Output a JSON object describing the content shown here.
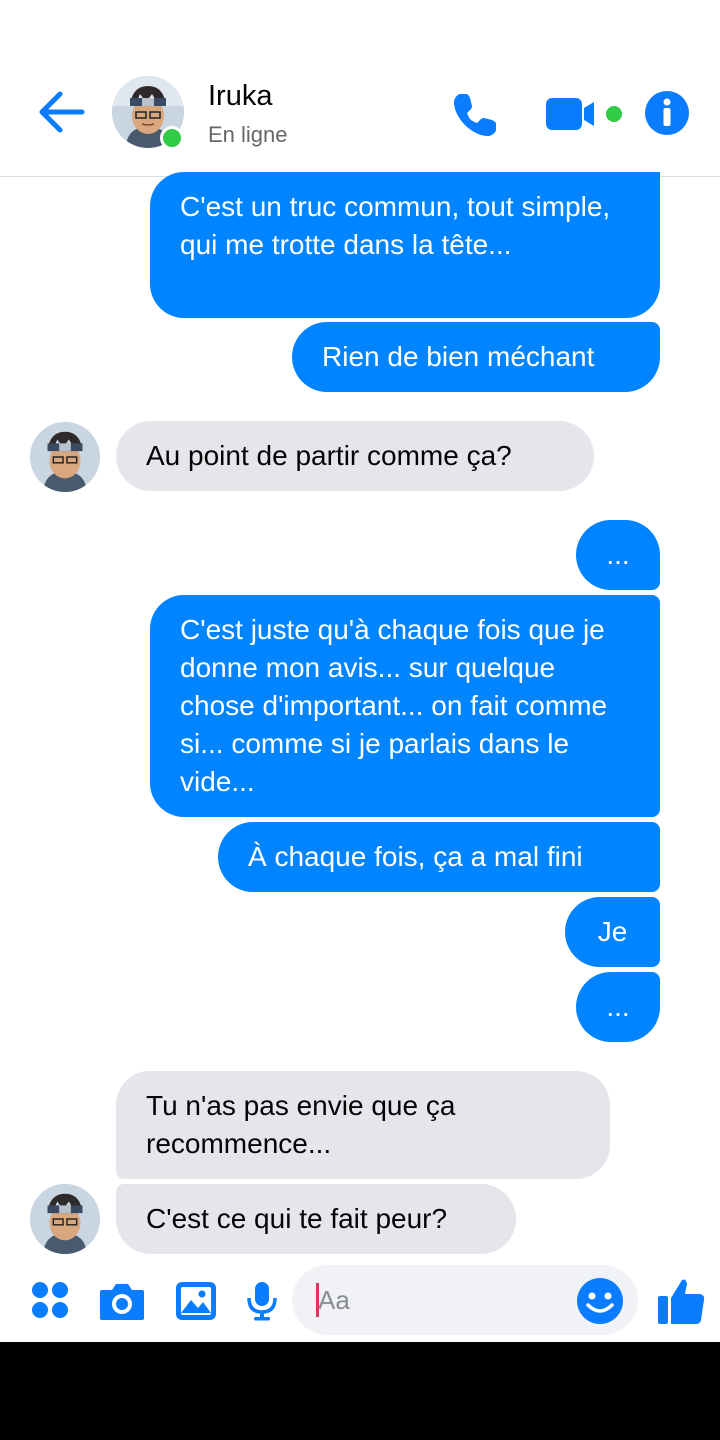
{
  "header": {
    "contact_name": "Iruka",
    "status": "En ligne"
  },
  "messages": [
    {
      "from": "me",
      "text": "C'est un truc commun, tout simple, qui me trotte dans la tête..."
    },
    {
      "from": "me",
      "text": "Rien de bien méchant"
    },
    {
      "from": "them",
      "text": "Au point de partir comme ça?"
    },
    {
      "from": "me",
      "text": "..."
    },
    {
      "from": "me",
      "text": "C'est juste qu'à chaque fois que je donne mon avis... sur quelque chose d'important... on fait comme si... comme si je parlais dans le vide..."
    },
    {
      "from": "me",
      "text": "À chaque fois, ça a mal fini"
    },
    {
      "from": "me",
      "text": "Je"
    },
    {
      "from": "me",
      "text": "..."
    },
    {
      "from": "them",
      "text": "Tu n'as pas envie que ça recommence..."
    },
    {
      "from": "them",
      "text": "C'est ce qui te fait peur?"
    }
  ],
  "composer": {
    "placeholder": "Aa"
  },
  "icons": {
    "back": "back-arrow-icon",
    "call": "phone-icon",
    "video": "video-camera-icon",
    "info": "info-icon",
    "menu": "four-dots-icon",
    "camera": "camera-icon",
    "gallery": "image-icon",
    "mic": "microphone-icon",
    "emoji": "smiley-icon",
    "like": "thumbs-up-icon"
  },
  "colors": {
    "accent": "#0084ff",
    "incoming_bubble": "#e4e6eb",
    "online": "#31cc46"
  }
}
